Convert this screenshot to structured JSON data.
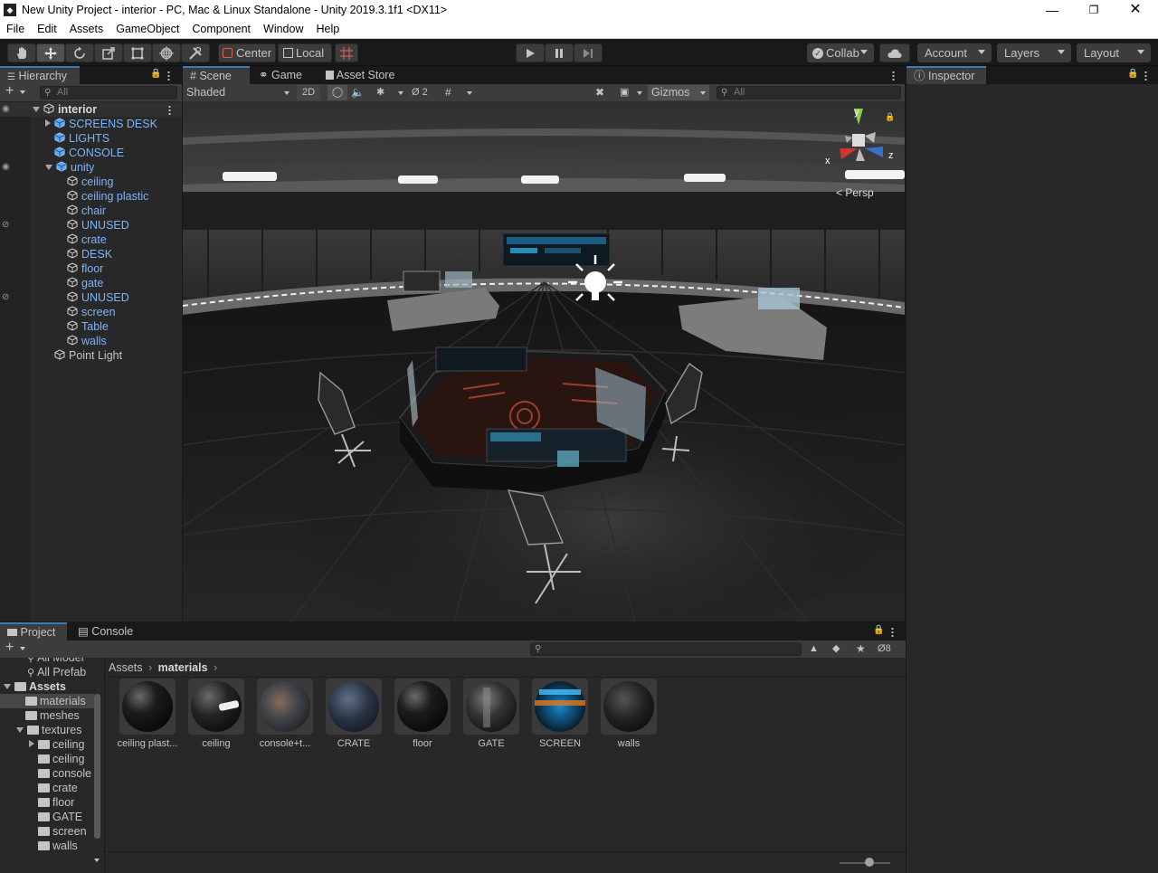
{
  "titlebar": {
    "title": "New Unity Project - interior - PC, Mac & Linux Standalone - Unity 2019.3.1f1 <DX11>"
  },
  "menu": [
    "File",
    "Edit",
    "Assets",
    "GameObject",
    "Component",
    "Window",
    "Help"
  ],
  "toolbar": {
    "center": "Center",
    "local": "Local",
    "collab": "Collab",
    "account": "Account",
    "layers": "Layers",
    "layout": "Layout"
  },
  "hierarchy": {
    "tab": "Hierarchy",
    "search_placeholder": "All",
    "items": [
      {
        "label": "interior",
        "depth": 0,
        "fold": "open",
        "type": "scene",
        "style": "bold"
      },
      {
        "label": "SCREENS DESK",
        "depth": 1,
        "fold": "closed",
        "type": "prefab"
      },
      {
        "label": "LIGHTS",
        "depth": 1,
        "fold": "none",
        "type": "prefab"
      },
      {
        "label": "CONSOLE",
        "depth": 1,
        "fold": "none",
        "type": "prefab"
      },
      {
        "label": "unity",
        "depth": 1,
        "fold": "open",
        "type": "prefab"
      },
      {
        "label": "ceiling",
        "depth": 2,
        "fold": "none",
        "type": "object"
      },
      {
        "label": "ceiling plastic",
        "depth": 2,
        "fold": "none",
        "type": "object"
      },
      {
        "label": "chair",
        "depth": 2,
        "fold": "none",
        "type": "object"
      },
      {
        "label": "UNUSED",
        "depth": 2,
        "fold": "none",
        "type": "object"
      },
      {
        "label": "crate",
        "depth": 2,
        "fold": "none",
        "type": "object"
      },
      {
        "label": "DESK",
        "depth": 2,
        "fold": "none",
        "type": "object"
      },
      {
        "label": "floor",
        "depth": 2,
        "fold": "none",
        "type": "object"
      },
      {
        "label": "gate",
        "depth": 2,
        "fold": "none",
        "type": "object"
      },
      {
        "label": "UNUSED",
        "depth": 2,
        "fold": "none",
        "type": "object"
      },
      {
        "label": "screen",
        "depth": 2,
        "fold": "none",
        "type": "object"
      },
      {
        "label": "Table",
        "depth": 2,
        "fold": "none",
        "type": "object"
      },
      {
        "label": "walls",
        "depth": 2,
        "fold": "none",
        "type": "object"
      },
      {
        "label": "Point Light",
        "depth": 1,
        "fold": "none",
        "type": "plain"
      }
    ]
  },
  "scene": {
    "tabs": [
      "Scene",
      "Game",
      "Asset Store"
    ],
    "shading": "Shaded",
    "mode_2d": "2D",
    "hidden_count": "2",
    "gizmos": "Gizmos",
    "search_placeholder": "All",
    "persp": "< Persp",
    "axis": {
      "x": "x",
      "y": "y",
      "z": "z"
    }
  },
  "inspector": {
    "tab": "Inspector"
  },
  "project": {
    "tabs": [
      "Project",
      "Console"
    ],
    "hidden_count": "8",
    "breadcrumb": [
      "Assets",
      "materials"
    ],
    "tree": [
      {
        "label": "All Model",
        "depth": 1,
        "kind": "search"
      },
      {
        "label": "All Prefab",
        "depth": 1,
        "kind": "search"
      },
      {
        "label": "Assets",
        "depth": 0,
        "kind": "folder",
        "fold": "open",
        "bold": true
      },
      {
        "label": "materials",
        "depth": 1,
        "kind": "folder",
        "fold": "none",
        "selected": true
      },
      {
        "label": "meshes",
        "depth": 1,
        "kind": "folder",
        "fold": "none"
      },
      {
        "label": "textures",
        "depth": 1,
        "kind": "folder",
        "fold": "open"
      },
      {
        "label": "ceiling",
        "depth": 2,
        "kind": "folder",
        "fold": "closed"
      },
      {
        "label": "ceiling",
        "depth": 2,
        "kind": "folder",
        "fold": "none"
      },
      {
        "label": "console",
        "depth": 2,
        "kind": "folder",
        "fold": "none"
      },
      {
        "label": "crate",
        "depth": 2,
        "kind": "folder",
        "fold": "none"
      },
      {
        "label": "floor",
        "depth": 2,
        "kind": "folder",
        "fold": "none"
      },
      {
        "label": "GATE",
        "depth": 2,
        "kind": "folder",
        "fold": "none"
      },
      {
        "label": "screen",
        "depth": 2,
        "kind": "folder",
        "fold": "none"
      },
      {
        "label": "walls",
        "depth": 2,
        "kind": "folder",
        "fold": "none"
      }
    ],
    "materials": [
      {
        "label": "ceiling plast...",
        "look": "black"
      },
      {
        "label": "ceiling",
        "look": "stripe"
      },
      {
        "label": "console+t...",
        "look": "console"
      },
      {
        "label": "CRATE",
        "look": "crate"
      },
      {
        "label": "floor",
        "look": "black"
      },
      {
        "label": "GATE",
        "look": "gate"
      },
      {
        "label": "SCREEN",
        "look": "screen"
      },
      {
        "label": "walls",
        "look": "walls"
      }
    ]
  },
  "colors": {
    "accent": "#3a79bb",
    "prefab_text": "#7bb4ff",
    "panel": "#282828",
    "header": "#3c3c3c"
  }
}
